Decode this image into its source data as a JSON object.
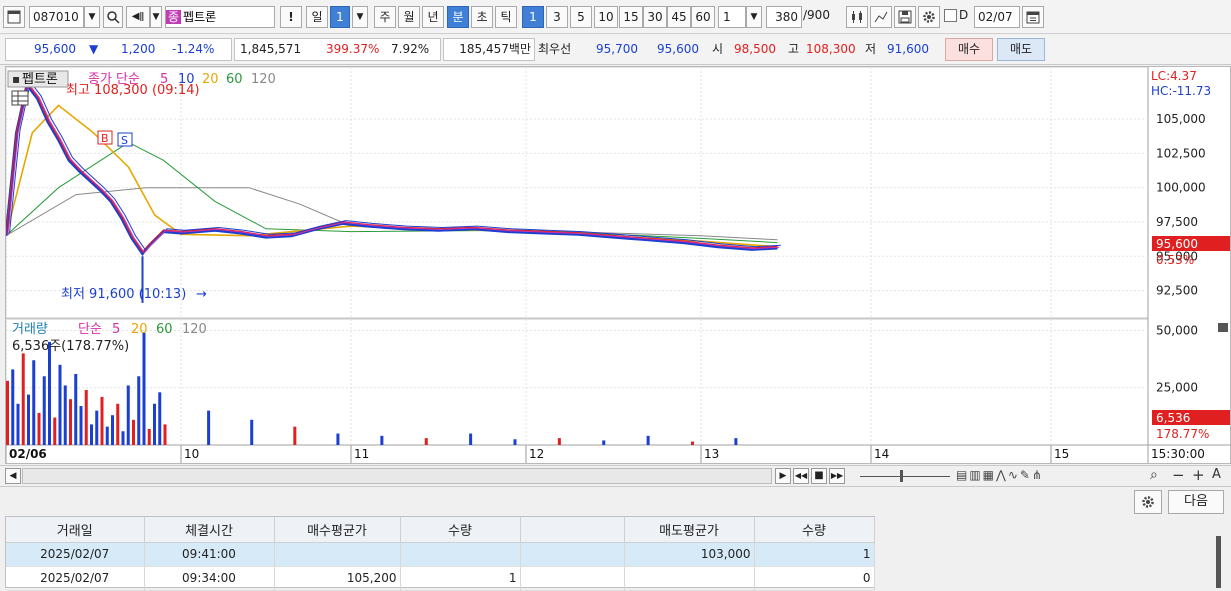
{
  "toolbar": {
    "code": "087010",
    "stock_name": "펩트론",
    "stock_badge": "종",
    "exclaim": "!",
    "periods": [
      "일",
      "1",
      "주",
      "월",
      "년",
      "분",
      "초",
      "틱"
    ],
    "minutes": [
      "1",
      "3",
      "5",
      "10",
      "15",
      "30",
      "45",
      "60"
    ],
    "interval_value": "1",
    "count": "380",
    "count_max": "/900",
    "d_label": "D",
    "date": "02/07"
  },
  "quote": {
    "price": "95,600",
    "arrow": "▼",
    "change": "1,200",
    "change_pct": "-1.24%",
    "volume": "1,845,571",
    "volume_ratio": "399.37%",
    "turnover": "7.92%",
    "amount": "185,457백만",
    "best_label": "최우선",
    "best_ask": "95,700",
    "best_bid": "95,600",
    "open_label": "시",
    "open": "98,500",
    "high_label": "고",
    "high": "108,300",
    "low_label": "저",
    "low": "91,600",
    "buy_label": "매수",
    "sell_label": "매도"
  },
  "price_panel": {
    "name": "펩트론",
    "legend_prefix": "종가 단순",
    "ma": [
      "5",
      "10",
      "20",
      "60",
      "120"
    ],
    "high_note": "최고 108,300 (09:14)",
    "low_note": "최저 91,600 (10:13)",
    "lc": "LC:4.37",
    "hc": "HC:-11.73",
    "last_price": "95,600",
    "last_pct": "0.53%",
    "b_marker": "B",
    "s_marker": "S"
  },
  "volume_panel": {
    "legend_prefix": "거래량",
    "legend_type": "단순",
    "ma": [
      "5",
      "20",
      "60",
      "120"
    ],
    "note": "6,536주(178.77%)",
    "last": "6,536",
    "last_pct": "178.77%"
  },
  "x_labels": [
    "02/06",
    "10",
    "11",
    "12",
    "13",
    "14",
    "15"
  ],
  "time_label": "15:30:00",
  "table": {
    "headers": [
      "거래일",
      "체결시간",
      "매수평균가",
      "수량",
      "",
      "매도평균가",
      "수량"
    ],
    "rows": [
      [
        "2025/02/07",
        "09:41:00",
        "",
        "",
        "",
        "103,000",
        "1"
      ],
      [
        "2025/02/07",
        "09:34:00",
        "105,200",
        "1",
        "",
        "",
        "0"
      ]
    ]
  },
  "next_label": "다음",
  "colors": {
    "up": "#e02020",
    "down": "#1b3fd0",
    "ma5": "#d62fa6",
    "ma10": "#1f3fd0",
    "ma20": "#e6a700",
    "ma60": "#2a9a3a",
    "ma120": "#888888"
  },
  "chart_data": {
    "type": "candlestick",
    "title": "펩트론",
    "y_axis": [
      92500,
      95000,
      97500,
      100000,
      102500,
      105000
    ],
    "y_labels": [
      "92,500",
      "95,000",
      "97,500",
      "100,000",
      "102,500",
      "105,000"
    ],
    "vol_axis": [
      25000,
      50000
    ],
    "vol_labels": [
      "25,000",
      "50,000"
    ],
    "x_categories": [
      "02/06",
      "10",
      "11",
      "12",
      "13",
      "14",
      "15"
    ],
    "price_points": [
      [
        0,
        96500
      ],
      [
        0.06,
        104000
      ],
      [
        0.12,
        107500
      ],
      [
        0.18,
        106500
      ],
      [
        0.24,
        104800
      ],
      [
        0.3,
        103500
      ],
      [
        0.36,
        102000
      ],
      [
        0.42,
        101200
      ],
      [
        0.48,
        100500
      ],
      [
        0.54,
        99800
      ],
      [
        0.6,
        99000
      ],
      [
        0.66,
        97800
      ],
      [
        0.72,
        96300
      ],
      [
        0.78,
        95200
      ],
      [
        0.82,
        95800
      ],
      [
        0.9,
        96800
      ],
      [
        1.0,
        96700
      ],
      [
        1.2,
        96900
      ],
      [
        1.35,
        96700
      ],
      [
        1.5,
        96400
      ],
      [
        1.65,
        96500
      ],
      [
        1.8,
        97000
      ],
      [
        1.95,
        97400
      ],
      [
        2.1,
        97200
      ],
      [
        2.3,
        97000
      ],
      [
        2.5,
        96900
      ],
      [
        2.7,
        97000
      ],
      [
        2.9,
        96800
      ],
      [
        3.1,
        96700
      ],
      [
        3.3,
        96600
      ],
      [
        3.5,
        96400
      ],
      [
        3.7,
        96200
      ],
      [
        3.9,
        96000
      ],
      [
        4.1,
        95700
      ],
      [
        4.3,
        95500
      ],
      [
        4.45,
        95600
      ]
    ],
    "ma20_points": [
      [
        0,
        96500
      ],
      [
        0.15,
        104000
      ],
      [
        0.3,
        106000
      ],
      [
        0.5,
        104000
      ],
      [
        0.7,
        101500
      ],
      [
        0.85,
        98000
      ],
      [
        1.0,
        96600
      ],
      [
        1.4,
        96500
      ],
      [
        2.0,
        97200
      ],
      [
        3.0,
        96800
      ],
      [
        4.0,
        96100
      ],
      [
        4.45,
        95700
      ]
    ],
    "ma60_points": [
      [
        0,
        96500
      ],
      [
        0.3,
        100000
      ],
      [
        0.7,
        103300
      ],
      [
        0.9,
        102000
      ],
      [
        1.2,
        99000
      ],
      [
        1.5,
        97000
      ],
      [
        2.0,
        96800
      ],
      [
        3.0,
        96900
      ],
      [
        4.0,
        96300
      ],
      [
        4.45,
        96000
      ]
    ],
    "ma120_points": [
      [
        0,
        96500
      ],
      [
        0.4,
        99500
      ],
      [
        0.8,
        100000
      ],
      [
        1.4,
        100000
      ],
      [
        1.7,
        98800
      ],
      [
        2.0,
        97200
      ],
      [
        2.6,
        96900
      ],
      [
        3.2,
        96800
      ],
      [
        4.0,
        96500
      ],
      [
        4.45,
        96200
      ]
    ],
    "volume": [
      28000,
      33000,
      18000,
      40000,
      22000,
      37000,
      14000,
      30000,
      45000,
      12000,
      35000,
      26000,
      20000,
      31000,
      17000,
      24000,
      9000,
      15000,
      21000,
      8000,
      13000,
      18000,
      6000,
      26000,
      11000,
      30000,
      49000,
      7000,
      18000,
      23000,
      9000,
      15000,
      11000,
      8000,
      5000,
      4000,
      3000,
      5000,
      2500,
      3000,
      2000,
      4000,
      1500,
      3000
    ]
  }
}
